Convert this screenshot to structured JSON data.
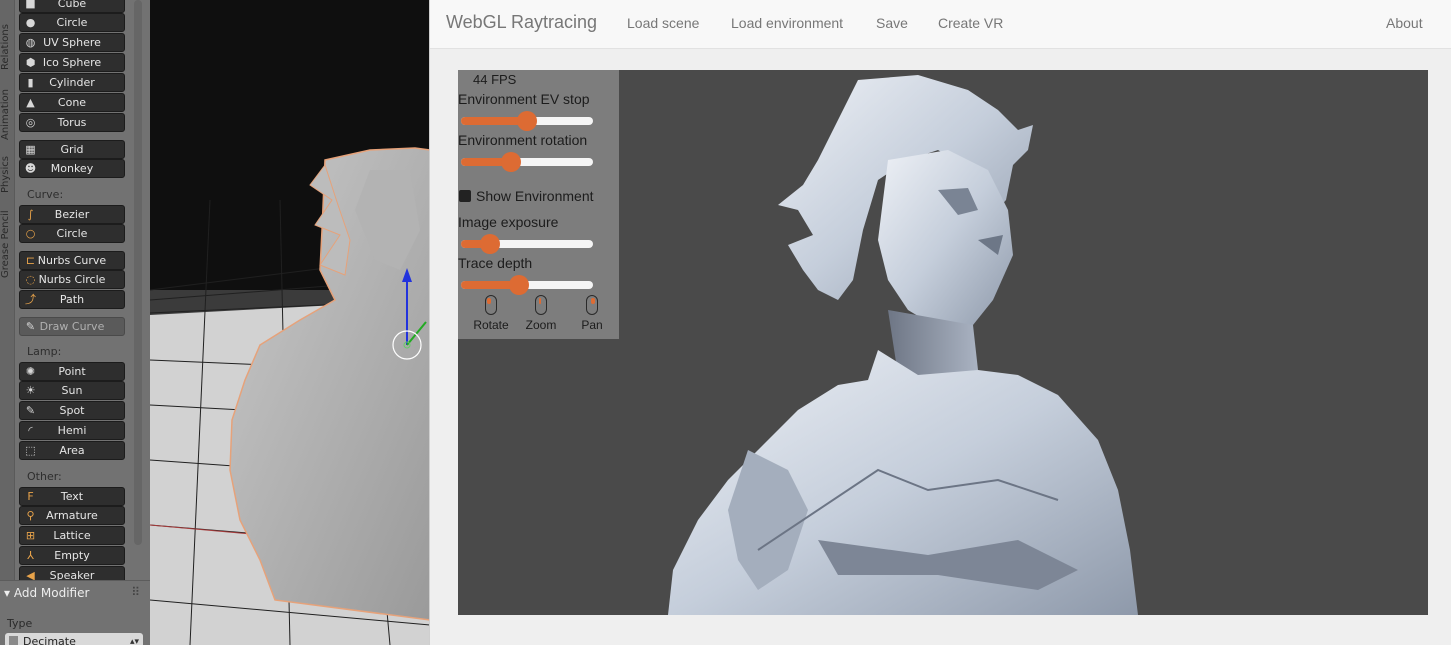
{
  "blender": {
    "tabs": [
      "Relations",
      "Animation",
      "Physics",
      "Grease Pencil"
    ],
    "mesh_tools": [
      {
        "label": "Cube",
        "icon": "cube-icon",
        "glyph": "■"
      },
      {
        "label": "Circle",
        "icon": "circle-icon",
        "glyph": "●"
      },
      {
        "label": "UV Sphere",
        "icon": "uv-sphere-icon",
        "glyph": "◍"
      },
      {
        "label": "Ico Sphere",
        "icon": "ico-sphere-icon",
        "glyph": "⬢"
      },
      {
        "label": "Cylinder",
        "icon": "cylinder-icon",
        "glyph": "▮"
      },
      {
        "label": "Cone",
        "icon": "cone-icon",
        "glyph": "▲"
      },
      {
        "label": "Torus",
        "icon": "torus-icon",
        "glyph": "◎"
      },
      {
        "label": "Grid",
        "icon": "grid-icon",
        "glyph": "▦"
      },
      {
        "label": "Monkey",
        "icon": "monkey-icon",
        "glyph": "☻"
      }
    ],
    "curve": {
      "header": "Curve:",
      "items": [
        {
          "label": "Bezier",
          "icon": "bezier-icon",
          "glyph": "∫"
        },
        {
          "label": "Circle",
          "icon": "curve-circle-icon",
          "glyph": "○"
        },
        {
          "label": "Nurbs Curve",
          "icon": "nurbs-curve-icon",
          "glyph": "⊏"
        },
        {
          "label": "Nurbs Circle",
          "icon": "nurbs-circle-icon",
          "glyph": "◌"
        },
        {
          "label": "Path",
          "icon": "path-icon",
          "glyph": "⤴"
        }
      ],
      "draw_curve": "Draw Curve"
    },
    "lamp": {
      "header": "Lamp:",
      "items": [
        {
          "label": "Point",
          "icon": "point-lamp-icon",
          "glyph": "✺"
        },
        {
          "label": "Sun",
          "icon": "sun-lamp-icon",
          "glyph": "☀"
        },
        {
          "label": "Spot",
          "icon": "spot-lamp-icon",
          "glyph": "✎"
        },
        {
          "label": "Hemi",
          "icon": "hemi-lamp-icon",
          "glyph": "◜"
        },
        {
          "label": "Area",
          "icon": "area-lamp-icon",
          "glyph": "⬚"
        }
      ]
    },
    "other": {
      "header": "Other:",
      "items": [
        {
          "label": "Text",
          "icon": "text-icon",
          "glyph": "F"
        },
        {
          "label": "Armature",
          "icon": "armature-icon",
          "glyph": "⚲"
        },
        {
          "label": "Lattice",
          "icon": "lattice-icon",
          "glyph": "⊞"
        },
        {
          "label": "Empty",
          "icon": "empty-icon",
          "glyph": "⅄"
        },
        {
          "label": "Speaker",
          "icon": "speaker-icon",
          "glyph": "◀"
        }
      ]
    },
    "modifier": {
      "header": "Add Modifier",
      "type_label": "Type",
      "type_value": "Decimate"
    }
  },
  "app": {
    "brand": "WebGL Raytracing",
    "nav": [
      "Load scene",
      "Load environment",
      "Save",
      "Create VR"
    ],
    "about": "About",
    "panel": {
      "fps": "44 FPS",
      "ev_label": "Environment EV stop",
      "ev_value": 0.5,
      "rotation_label": "Environment rotation",
      "rotation_value": 0.38,
      "show_env_label": "Show Environment",
      "show_env_checked": false,
      "exposure_label": "Image exposure",
      "exposure_value": 0.22,
      "depth_label": "Trace depth",
      "depth_value": 0.44,
      "mouse_hints": [
        "Rotate",
        "Zoom",
        "Pan"
      ]
    }
  },
  "colors": {
    "accent": "#dd6b33",
    "blender_button": "#2e2e2e",
    "render_bg": "#4a4a4a"
  }
}
